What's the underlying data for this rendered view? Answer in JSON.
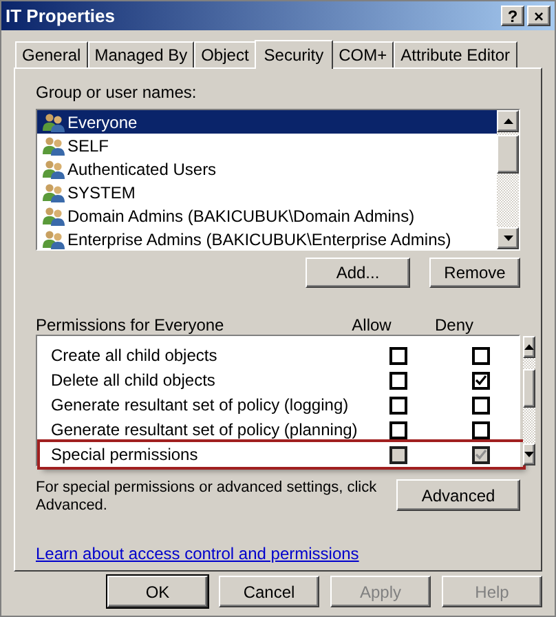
{
  "window": {
    "title": "IT Properties",
    "title_buttons": [
      "?",
      "×"
    ]
  },
  "tabs": [
    {
      "label": "General",
      "selected": false
    },
    {
      "label": "Managed By",
      "selected": false
    },
    {
      "label": "Object",
      "selected": false
    },
    {
      "label": "Security",
      "selected": true
    },
    {
      "label": "COM+",
      "selected": false
    },
    {
      "label": "Attribute Editor",
      "selected": false
    }
  ],
  "users": {
    "label": "Group or user names:",
    "items": [
      {
        "name": "Everyone",
        "selected": true
      },
      {
        "name": "SELF",
        "selected": false
      },
      {
        "name": "Authenticated Users",
        "selected": false
      },
      {
        "name": "SYSTEM",
        "selected": false
      },
      {
        "name": "Domain Admins (BAKICUBUK\\Domain Admins)",
        "selected": false
      },
      {
        "name": "Enterprise Admins (BAKICUBUK\\Enterprise Admins)",
        "selected": false
      }
    ],
    "buttons": [
      "Add...",
      "Remove"
    ]
  },
  "permissions": {
    "label": "Permissions for Everyone",
    "columns": [
      "Allow",
      "Deny"
    ],
    "rows": [
      {
        "label": "Create all child objects",
        "allow": false,
        "deny": false,
        "disabled": false,
        "highlighted": false
      },
      {
        "label": "Delete all child objects",
        "allow": false,
        "deny": true,
        "disabled": false,
        "highlighted": false
      },
      {
        "label": "Generate resultant set of policy (logging)",
        "allow": false,
        "deny": false,
        "disabled": false,
        "highlighted": false
      },
      {
        "label": "Generate resultant set of policy (planning)",
        "allow": false,
        "deny": false,
        "disabled": false,
        "highlighted": false
      },
      {
        "label": "Special permissions",
        "allow": false,
        "deny": true,
        "disabled": true,
        "highlighted": true
      }
    ]
  },
  "advanced": {
    "text": "For special permissions or advanced settings, click Advanced.",
    "button": "Advanced"
  },
  "link": "Learn about access control and permissions",
  "footer_buttons": [
    {
      "label": "OK",
      "disabled": false
    },
    {
      "label": "Cancel",
      "disabled": false
    },
    {
      "label": "Apply",
      "disabled": true
    },
    {
      "label": "Help",
      "disabled": true
    }
  ]
}
